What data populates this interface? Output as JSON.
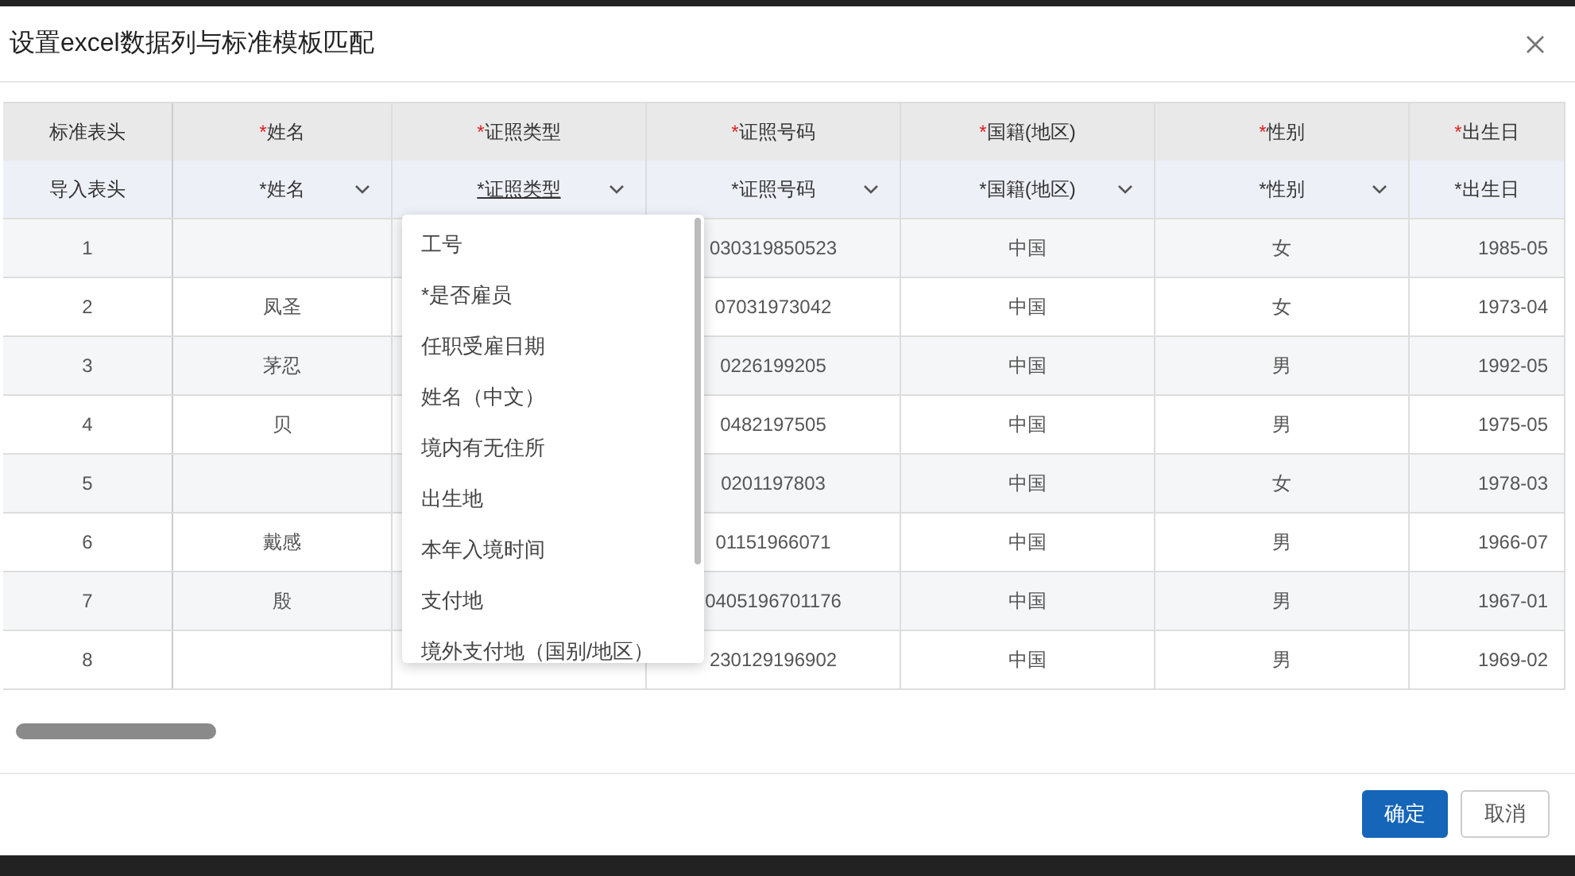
{
  "dialog": {
    "title": "设置excel数据列与标准模板匹配"
  },
  "table": {
    "standard_label": "标准表头",
    "import_label": "导入表头",
    "columns": [
      {
        "marker": "*",
        "standard": "姓名",
        "import": "*姓名",
        "selected": false
      },
      {
        "marker": "*",
        "standard": "证照类型",
        "import": "*证照类型",
        "selected": true
      },
      {
        "marker": "*",
        "standard": "证照号码",
        "import": "*证照号码",
        "selected": false
      },
      {
        "marker": "*",
        "standard": "国籍(地区)",
        "import": "*国籍(地区)",
        "selected": false
      },
      {
        "marker": "*",
        "standard": "性别",
        "import": "*性别",
        "selected": false
      },
      {
        "marker": "*",
        "standard": "出生日",
        "import": "*出生日",
        "selected": false
      }
    ],
    "rows": [
      {
        "index": "1",
        "cells": [
          "",
          "",
          "030319850523",
          "中国",
          "女",
          "1985-05"
        ]
      },
      {
        "index": "2",
        "cells": [
          "凤圣",
          "",
          "07031973042",
          "中国",
          "女",
          "1973-04"
        ]
      },
      {
        "index": "3",
        "cells": [
          "茅忍",
          "",
          "0226199205",
          "中国",
          "男",
          "1992-05"
        ]
      },
      {
        "index": "4",
        "cells": [
          "贝",
          "",
          "0482197505",
          "中国",
          "男",
          "1975-05"
        ]
      },
      {
        "index": "5",
        "cells": [
          "",
          "",
          "0201197803",
          "中国",
          "女",
          "1978-03"
        ]
      },
      {
        "index": "6",
        "cells": [
          "戴感",
          "",
          "01151966071",
          "中国",
          "男",
          "1966-07"
        ]
      },
      {
        "index": "7",
        "cells": [
          "殷",
          "",
          "0405196701176",
          "中国",
          "男",
          "1967-01"
        ]
      },
      {
        "index": "8",
        "cells": [
          "",
          "",
          "230129196902",
          "中国",
          "男",
          "1969-02"
        ]
      }
    ]
  },
  "dropdown": {
    "options": [
      "工号",
      "*是否雇员",
      "任职受雇日期",
      "姓名（中文）",
      "境内有无住所",
      "出生地",
      "本年入境时间",
      "支付地",
      "境外支付地（国别/地区）"
    ]
  },
  "buttons": [
    {
      "label": "确定",
      "kind": "primary"
    },
    {
      "label": "取消",
      "kind": "secondary"
    }
  ]
}
